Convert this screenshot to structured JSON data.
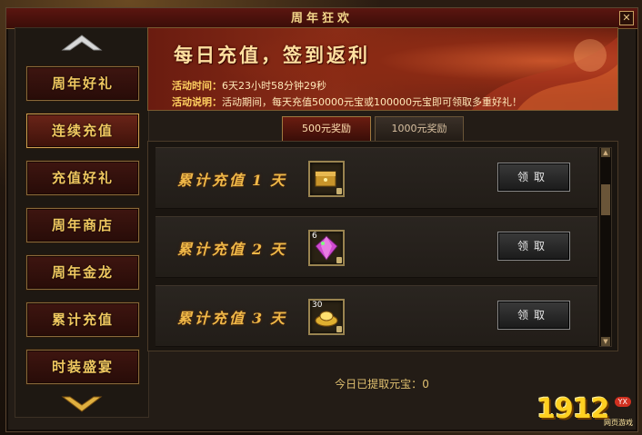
{
  "window": {
    "title": "周年狂欢",
    "close_label": "✕"
  },
  "sidebar": {
    "items": [
      {
        "label": "周年好礼",
        "active": false
      },
      {
        "label": "连续充值",
        "active": true
      },
      {
        "label": "充值好礼",
        "active": false
      },
      {
        "label": "周年商店",
        "active": false
      },
      {
        "label": "周年金龙",
        "active": false
      },
      {
        "label": "累计充值",
        "active": false
      },
      {
        "label": "时装盛宴",
        "active": false
      }
    ]
  },
  "banner": {
    "title": "每日充值，签到返利",
    "time_label": "活动时间：",
    "time_value": "6天23小时58分钟29秒",
    "desc_label": "活动说明：",
    "desc_value": "活动期间，每天充值50000元宝或100000元宝即可领取多重好礼！"
  },
  "tabs": [
    {
      "label": "500元奖励",
      "active": true
    },
    {
      "label": "1000元奖励",
      "active": false
    }
  ],
  "rewards": [
    {
      "prefix": "累计充值",
      "day": "1",
      "suffix": "天",
      "item_count": "",
      "item_color": "#c8942a",
      "claim_label": "领取"
    },
    {
      "prefix": "累计充值",
      "day": "2",
      "suffix": "天",
      "item_count": "6",
      "item_color": "#d04ad0",
      "claim_label": "领取"
    },
    {
      "prefix": "累计充值",
      "day": "3",
      "suffix": "天",
      "item_count": "30",
      "item_color": "#e0b030",
      "claim_label": "领取"
    }
  ],
  "footer": {
    "label": "今日已提取元宝：",
    "value": "0"
  },
  "logo": {
    "number": "1912",
    "badge": "YX",
    "sub": "网页游戏"
  }
}
